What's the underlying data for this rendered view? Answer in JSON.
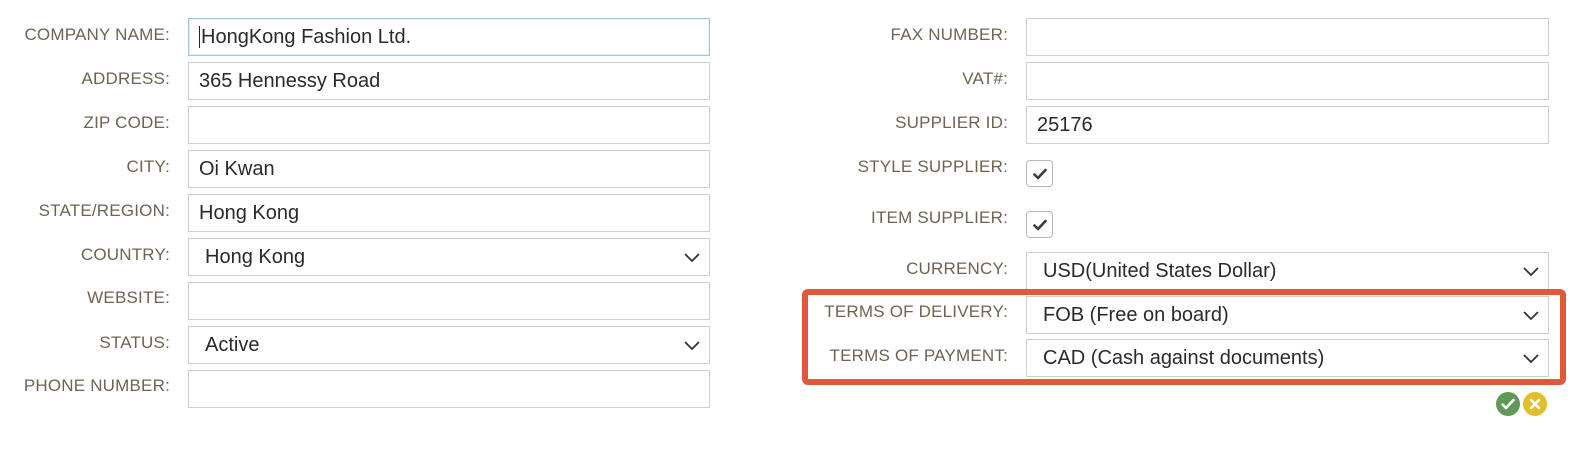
{
  "left": {
    "company_name": {
      "label": "COMPANY NAME:",
      "value": "HongKong Fashion Ltd."
    },
    "address": {
      "label": "ADDRESS:",
      "value": "365 Hennessy Road"
    },
    "zip_code": {
      "label": "ZIP CODE:",
      "value": ""
    },
    "city": {
      "label": "CITY:",
      "value": "Oi Kwan"
    },
    "state_region": {
      "label": "STATE/REGION:",
      "value": "Hong Kong"
    },
    "country": {
      "label": "COUNTRY:",
      "value": "Hong Kong"
    },
    "website": {
      "label": "WEBSITE:",
      "value": ""
    },
    "status": {
      "label": "STATUS:",
      "value": "Active"
    },
    "phone_number": {
      "label": "PHONE NUMBER:",
      "value": ""
    }
  },
  "right": {
    "fax_number": {
      "label": "FAX NUMBER:",
      "value": ""
    },
    "vat": {
      "label": "VAT#:",
      "value": ""
    },
    "supplier_id": {
      "label": "SUPPLIER ID:",
      "value": "25176"
    },
    "style_supplier": {
      "label": "STYLE SUPPLIER:",
      "checked": true
    },
    "item_supplier": {
      "label": "ITEM SUPPLIER:",
      "checked": true
    },
    "currency": {
      "label": "CURRENCY:",
      "value": "USD(United States Dollar)"
    },
    "terms_of_delivery": {
      "label": "TERMS OF DELIVERY:",
      "value": "FOB (Free on board)"
    },
    "terms_of_payment": {
      "label": "TERMS OF PAYMENT:",
      "value": "CAD (Cash against documents)"
    }
  },
  "icons": {
    "confirm": "check-circle-icon",
    "cancel": "x-circle-icon",
    "dropdown": "chevron-down-icon",
    "checkmark": "checkmark-icon"
  },
  "colors": {
    "label": "#6e6354",
    "highlight": "#e0573a",
    "confirm": "#5f9857",
    "cancel": "#e1be2e",
    "focus_border": "#9dc7dd"
  }
}
